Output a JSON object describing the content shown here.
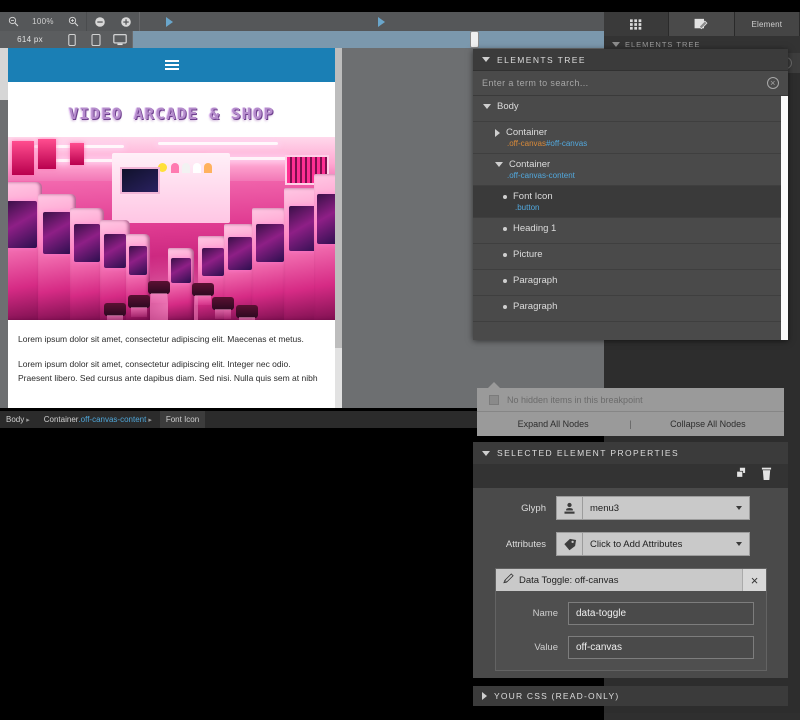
{
  "toolbar": {
    "zoom_out_icon": "zoom-out-icon",
    "zoom_level": "100%",
    "zoom_in_icon": "zoom-in-icon",
    "minus_icon": "minus-circle-icon",
    "plus_icon": "plus-circle-icon",
    "width_label": "614 px",
    "device_phone_icon": "phone-icon",
    "device_tablet_icon": "tablet-icon",
    "device_desktop_icon": "desktop-icon"
  },
  "panel_tabs": [
    {
      "label": "",
      "icon": "grid-icon"
    },
    {
      "label": "",
      "icon": "page-edit-icon"
    },
    {
      "label": "Element",
      "icon": ""
    }
  ],
  "background_panel": {
    "header": "ELEMENTS TREE",
    "search_placeholder": "Enter a term to search..."
  },
  "elements_tree": {
    "header": "ELEMENTS TREE",
    "search_placeholder": "Enter a term to search...",
    "clear_icon": "clear-circle-icon",
    "nodes": [
      {
        "name": "Body",
        "meta": "",
        "meta_color": "",
        "depth": 0,
        "toggle": "down",
        "selected": false,
        "bullet": false
      },
      {
        "name": "Container",
        "meta": ".off-canvas",
        "meta2": "#off-canvas",
        "depth": 1,
        "toggle": "right",
        "selected": false,
        "bullet": false
      },
      {
        "name": "Container",
        "meta": ".off-canvas-content",
        "meta2": "",
        "depth": 1,
        "toggle": "down",
        "selected": false,
        "bullet": false
      },
      {
        "name": "Font Icon",
        "meta": ".button",
        "meta2": "",
        "depth": 2,
        "toggle": "",
        "selected": true,
        "bullet": true
      },
      {
        "name": "Heading 1",
        "meta": "",
        "meta2": "",
        "depth": 2,
        "toggle": "",
        "selected": false,
        "bullet": true
      },
      {
        "name": "Picture",
        "meta": "",
        "meta2": "",
        "depth": 2,
        "toggle": "",
        "selected": false,
        "bullet": true
      },
      {
        "name": "Paragraph",
        "meta": "",
        "meta2": "",
        "depth": 2,
        "toggle": "",
        "selected": false,
        "bullet": true
      },
      {
        "name": "Paragraph",
        "meta": "",
        "meta2": "",
        "depth": 2,
        "toggle": "",
        "selected": false,
        "bullet": true
      }
    ]
  },
  "tree_popup": {
    "hidden_items_label": "No hidden items in this breakpoint",
    "expand_all": "Expand All Nodes",
    "divider": "|",
    "collapse_all": "Collapse All Nodes"
  },
  "selected_element_properties": {
    "header": "SELECTED ELEMENT PROPERTIES",
    "duplicate_icon": "duplicate-icon",
    "delete_icon": "trash-icon",
    "rows": [
      {
        "label": "Glyph",
        "icon": "stamp-icon",
        "value": "menu3"
      },
      {
        "label": "Attributes",
        "icon": "tag-icon",
        "value": "Click to Add Attributes"
      }
    ],
    "attribute_card": {
      "icon": "pencil-icon",
      "title": "Data Toggle: off-canvas",
      "close_icon": "close-icon",
      "name_label": "Name",
      "name_value": "data-toggle",
      "value_label": "Value",
      "value_value": "off-canvas"
    }
  },
  "your_css": {
    "header": "YOUR CSS (READ-ONLY)"
  },
  "breadcrumb": {
    "items": [
      {
        "tag": "Body",
        "sel": "",
        "active": false
      },
      {
        "tag": "Container",
        "sel": ".off-canvas-content",
        "active": false
      },
      {
        "tag": "Font Icon",
        "sel": "",
        "active": true
      }
    ],
    "arrow": "▸"
  },
  "page_preview": {
    "menu_icon": "hamburger-icon",
    "title": "VIDEO ARCADE & SHOP",
    "image_alt": "arcade-photo",
    "paragraphs": [
      "Lorem ipsum dolor sit amet, consectetur adipiscing elit. Maecenas et metus.",
      "Lorem ipsum dolor sit amet, consectetur adipiscing elit. Integer nec odio. Praesent libero. Sed cursus ante dapibus diam. Sed nisi. Nulla quis sem at nibh"
    ]
  },
  "colors": {
    "nav_blue": "#1a7fb5",
    "accent_blue": "#52a8dd",
    "accent_orange": "#d88a3a",
    "panel_dark": "#424242",
    "panel_row": "#4a4a4a"
  }
}
